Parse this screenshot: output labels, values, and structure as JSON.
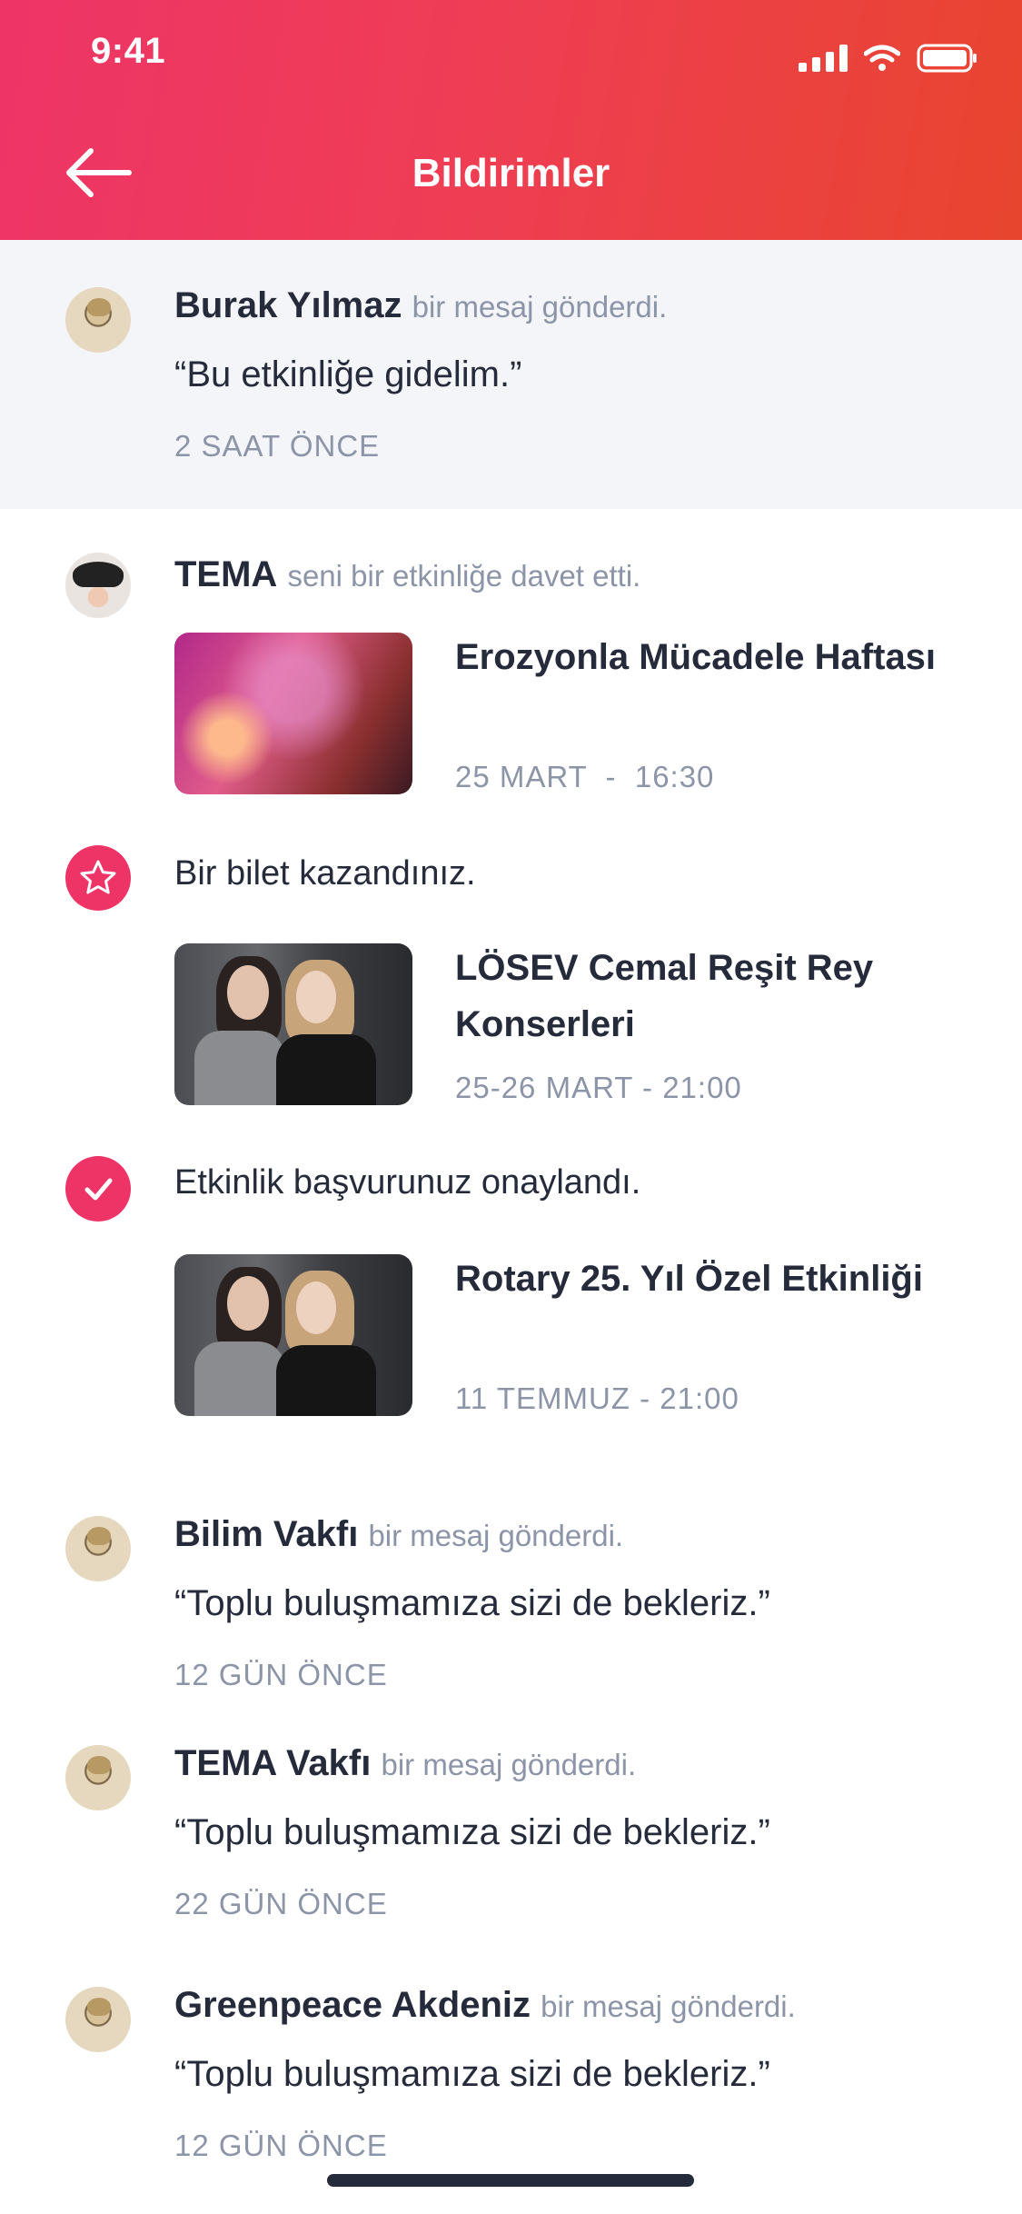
{
  "status_bar": {
    "time": "9:41"
  },
  "header": {
    "title": "Bildirimler"
  },
  "notifications": [
    {
      "name": "Burak Yılmaz",
      "action": "bir mesaj gönderdi.",
      "quote": "“Bu etkinliğe gidelim.”",
      "time": "2 SAAT ÖNCE"
    },
    {
      "name": "TEMA",
      "action": "seni bir etkinliğe davet etti.",
      "event_title": "Erozyonla Mücadele Haftası",
      "event_date": "25 MART  -  16:30"
    },
    {
      "text": "Bir bilet kazandınız.",
      "icon": "star-icon",
      "event_title": "LÖSEV Cemal Reşit Rey Konserleri",
      "event_date": "25-26 MART - 21:00"
    },
    {
      "text": "Etkinlik başvurunuz onaylandı.",
      "icon": "check-icon",
      "event_title": "Rotary 25. Yıl Özel Etkinliği",
      "event_date": "11 TEMMUZ - 21:00"
    },
    {
      "name": "Bilim Vakfı",
      "action": "bir mesaj gönderdi.",
      "quote": "“Toplu buluşmamıza sizi de bekleriz.”",
      "time": "12 GÜN ÖNCE"
    },
    {
      "name": "TEMA Vakfı",
      "action": "bir mesaj gönderdi.",
      "quote": "“Toplu buluşmamıza sizi de bekleriz.”",
      "time": "22 GÜN ÖNCE"
    },
    {
      "name": "Greenpeace Akdeniz",
      "action": "bir mesaj gönderdi.",
      "quote": "“Toplu buluşmamıza sizi de bekleriz.”",
      "time": "12 GÜN ÖNCE"
    }
  ],
  "colors": {
    "accent": "#ee3467",
    "header_end": "#e8452e",
    "muted": "#8c94a8",
    "text": "#262b3b",
    "highlight_bg": "#f4f5f9"
  }
}
